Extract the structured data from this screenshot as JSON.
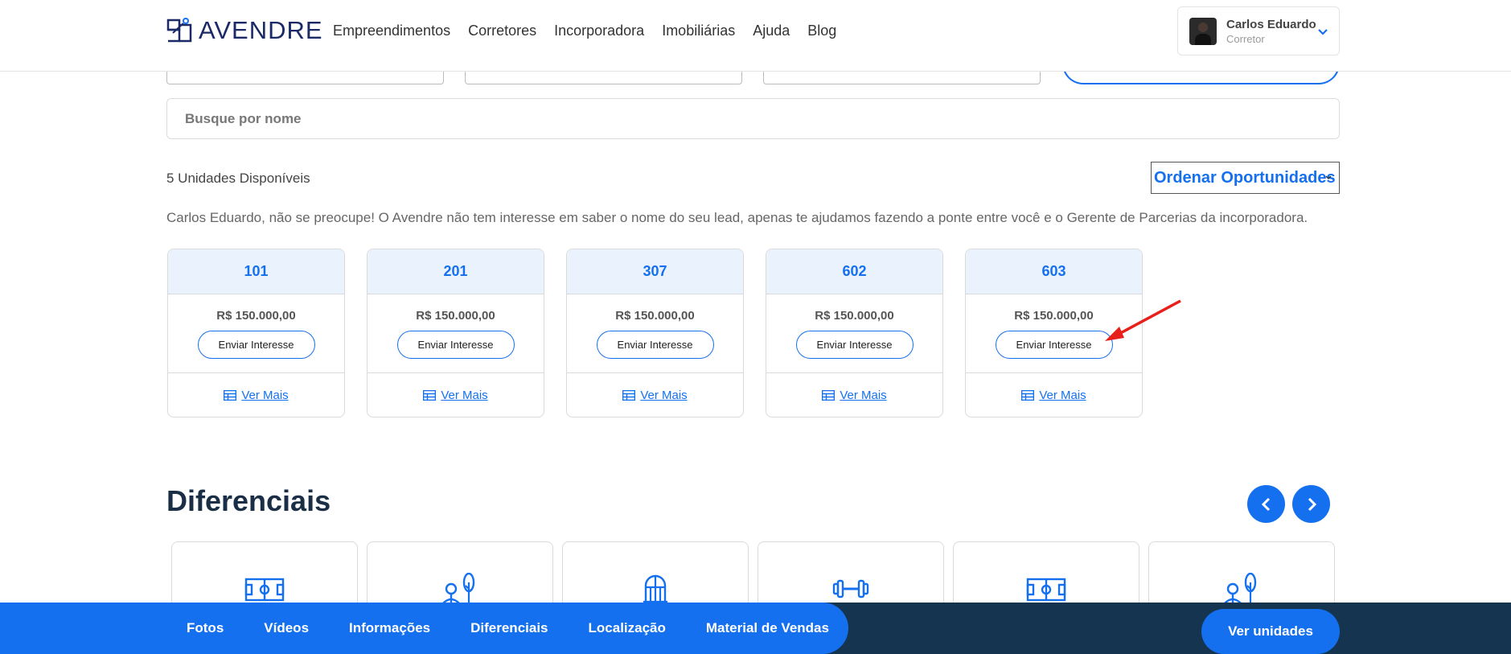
{
  "header": {
    "logo_text": "AVENDRE",
    "nav": [
      "Empreendimentos",
      "Corretores",
      "Incorporadora",
      "Imobiliárias",
      "Ajuda",
      "Blog"
    ],
    "user": {
      "name": "Carlos Eduardo",
      "role": "Corretor"
    }
  },
  "search": {
    "placeholder": "Busque por nome"
  },
  "units": {
    "count_label": "5 Unidades Disponíveis",
    "order_label": "Ordenar Oportunidades",
    "disclaimer": "Carlos Eduardo, não se preocupe! O Avendre não tem interesse em saber o nome do seu lead, apenas te ajudamos fazendo a ponte entre você e o Gerente de Parcerias da incorporadora.",
    "items": [
      {
        "number": "101",
        "price": "R$ 150.000,00",
        "button": "Enviar Interesse",
        "link": "Ver Mais"
      },
      {
        "number": "201",
        "price": "R$ 150.000,00",
        "button": "Enviar Interesse",
        "link": "Ver Mais"
      },
      {
        "number": "307",
        "price": "R$ 150.000,00",
        "button": "Enviar Interesse",
        "link": "Ver Mais"
      },
      {
        "number": "602",
        "price": "R$ 150.000,00",
        "button": "Enviar Interesse",
        "link": "Ver Mais"
      },
      {
        "number": "603",
        "price": "R$ 150.000,00",
        "button": "Enviar Interesse",
        "link": "Ver Mais"
      }
    ]
  },
  "diferenciais": {
    "title": "Diferenciais",
    "icons": [
      "sports-court-icon",
      "garden-icon",
      "gate-icon",
      "dumbbell-icon",
      "sports-court-icon",
      "garden-icon"
    ]
  },
  "bottom_nav": {
    "items": [
      "Fotos",
      "Vídeos",
      "Informações",
      "Diferenciais",
      "Localização",
      "Material de Vendas"
    ],
    "cta": "Ver unidades"
  },
  "colors": {
    "primary": "#1570ef",
    "dark": "#14344f",
    "card_head": "#eaf2fd",
    "annotation": "#e8201c"
  }
}
